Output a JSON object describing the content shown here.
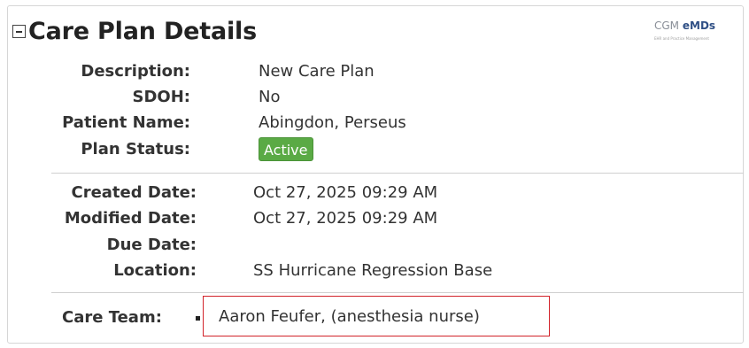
{
  "header": {
    "title": "Care Plan Details",
    "logo": {
      "brand": "CGM",
      "product": "eMDs",
      "tagline": "EHR and Practice Management"
    }
  },
  "plan": {
    "fields": [
      {
        "label": "Description:",
        "value": "New Care Plan"
      },
      {
        "label": "SDOH:",
        "value": "No"
      },
      {
        "label": "Patient Name:",
        "value": "Abingdon, Perseus"
      },
      {
        "label": "Plan Status:",
        "value": "Active"
      }
    ]
  },
  "dates": {
    "fields": [
      {
        "label": "Created Date:",
        "value": "Oct 27, 2025 09:29 AM"
      },
      {
        "label": "Modified Date:",
        "value": "Oct 27, 2025 09:29 AM"
      },
      {
        "label": "Due Date:",
        "value": ""
      },
      {
        "label": "Location:",
        "value": "SS Hurricane Regression Base"
      }
    ]
  },
  "care_team": {
    "label": "Care Team:",
    "members": [
      "Aaron Feufer, (anesthesia nurse)"
    ]
  },
  "colors": {
    "status_active": "#5aaa45",
    "highlight_border": "#d2232a",
    "logo_accent": "#2f4f85"
  }
}
